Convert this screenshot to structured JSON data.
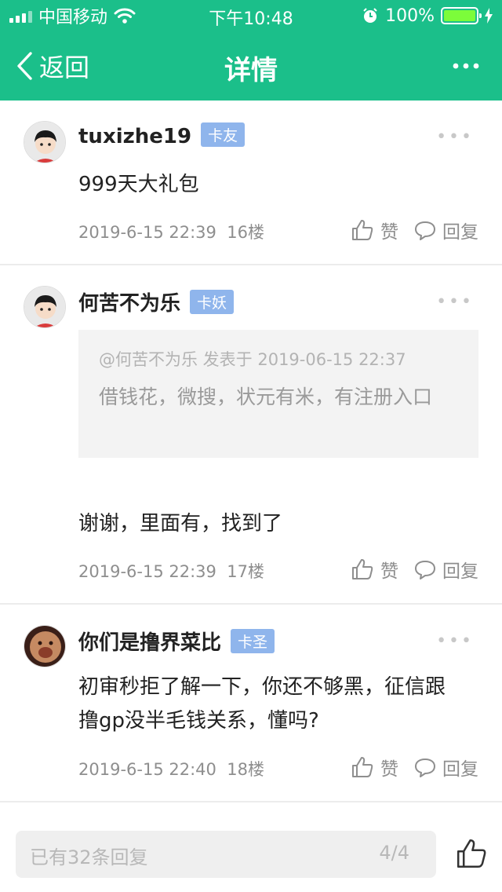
{
  "status_bar": {
    "carrier": "中国移动",
    "time": "下午10:48",
    "battery": "100%",
    "icons": [
      "signal-icon",
      "wifi-icon",
      "alarm-icon",
      "battery-icon",
      "charging-icon"
    ]
  },
  "nav": {
    "back_label": "返回",
    "title": "详情",
    "more_icon": "more-icon"
  },
  "posts": [
    {
      "username": "tuxizhe19",
      "badge": "卡友",
      "content": "999天大礼包",
      "date": "2019-6-15 22:39",
      "floor": "16楼",
      "like_label": "赞",
      "reply_label": "回复"
    },
    {
      "username": "何苦不为乐",
      "badge": "卡妖",
      "quote_header": "@何苦不为乐 发表于 2019-06-15 22:37",
      "quote_body": "借钱花，微搜，状元有米，有注册入口",
      "content": "谢谢，里面有，找到了",
      "date": "2019-6-15 22:39",
      "floor": "17楼",
      "like_label": "赞",
      "reply_label": "回复"
    },
    {
      "username": "你们是撸界菜比",
      "badge": "卡圣",
      "content": "初审秒拒了解一下，你还不够黑，征信跟撸gp没半毛钱关系，懂吗?",
      "date": "2019-6-15 22:40",
      "floor": "18楼",
      "like_label": "赞",
      "reply_label": "回复"
    }
  ],
  "bottom_bar": {
    "reply_placeholder": "已有32条回复",
    "page": "4/4"
  },
  "colors": {
    "header": "#1bbf8a",
    "badge": "#8fb5ec",
    "battery": "#7CFC3A",
    "meta_text": "#8e8e8e"
  }
}
